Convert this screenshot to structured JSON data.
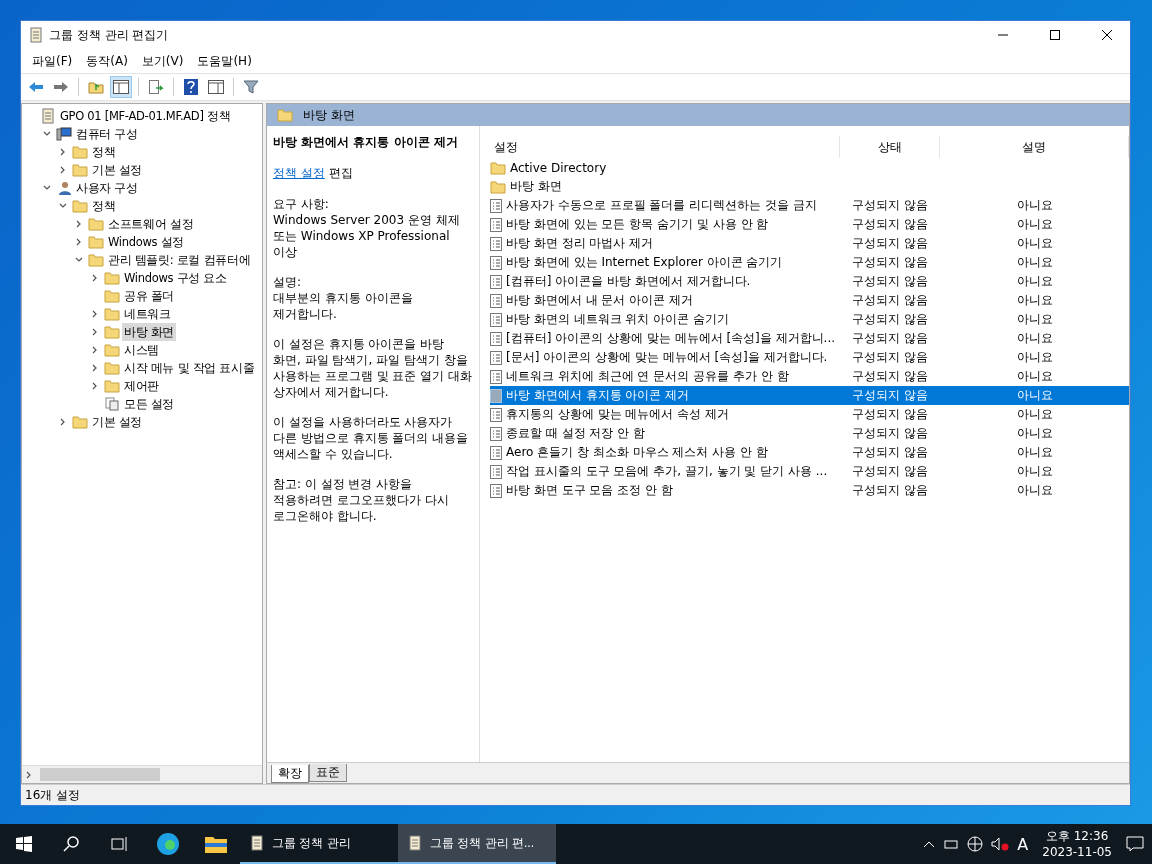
{
  "window": {
    "title": "그룹 정책 관리 편집기"
  },
  "menu": [
    "파일(F)",
    "동작(A)",
    "보기(V)",
    "도움말(H)"
  ],
  "toolbar": [
    {
      "kind": "back"
    },
    {
      "kind": "forward"
    },
    {
      "kind": "sep"
    },
    {
      "kind": "up"
    },
    {
      "kind": "pane",
      "selected": true
    },
    {
      "kind": "sep"
    },
    {
      "kind": "export"
    },
    {
      "kind": "sep"
    },
    {
      "kind": "help"
    },
    {
      "kind": "pane2"
    },
    {
      "kind": "sep"
    },
    {
      "kind": "filter"
    }
  ],
  "tree": [
    {
      "label": "GPO 01 [MF-AD-01.MF.AD] 정책",
      "kind": "policy",
      "expandable": false,
      "selected": false,
      "children": [
        {
          "label": "컴퓨터 구성",
          "kind": "computer",
          "expandable": true,
          "expanded": true,
          "selected": false,
          "children": [
            {
              "label": "정책",
              "kind": "folder",
              "expandable": true,
              "expanded": false,
              "selected": false
            },
            {
              "label": "기본 설정",
              "kind": "folder",
              "expandable": true,
              "expanded": false,
              "selected": false
            }
          ]
        },
        {
          "label": "사용자 구성",
          "kind": "user",
          "expandable": true,
          "expanded": true,
          "selected": false,
          "children": [
            {
              "label": "정책",
              "kind": "folder",
              "expandable": true,
              "expanded": true,
              "selected": false,
              "children": [
                {
                  "label": "소프트웨어 설정",
                  "kind": "folder",
                  "expandable": true,
                  "expanded": false,
                  "selected": false
                },
                {
                  "label": "Windows 설정",
                  "kind": "folder",
                  "expandable": true,
                  "expanded": false,
                  "selected": false
                },
                {
                  "label": "관리 템플릿: 로컬 컴퓨터에",
                  "kind": "folder",
                  "expandable": true,
                  "expanded": true,
                  "selected": false,
                  "children": [
                    {
                      "label": "Windows 구성 요소",
                      "kind": "folder",
                      "expandable": true,
                      "expanded": false,
                      "selected": false
                    },
                    {
                      "label": "공유 폴더",
                      "kind": "folder",
                      "expandable": false,
                      "selected": false
                    },
                    {
                      "label": "네트워크",
                      "kind": "folder",
                      "expandable": true,
                      "expanded": false,
                      "selected": false
                    },
                    {
                      "label": "바탕 화면",
                      "kind": "folder",
                      "expandable": true,
                      "expanded": false,
                      "selected": true
                    },
                    {
                      "label": "시스템",
                      "kind": "folder",
                      "expandable": true,
                      "expanded": false,
                      "selected": false
                    },
                    {
                      "label": "시작 메뉴 및 작업 표시줄",
                      "kind": "folder",
                      "expandable": true,
                      "expanded": false,
                      "selected": false
                    },
                    {
                      "label": "제어판",
                      "kind": "folder",
                      "expandable": true,
                      "expanded": false,
                      "selected": false
                    },
                    {
                      "label": "모든 설정",
                      "kind": "settings",
                      "expandable": false,
                      "selected": false
                    }
                  ]
                }
              ]
            },
            {
              "label": "기본 설정",
              "kind": "folder",
              "expandable": true,
              "expanded": false,
              "selected": false
            }
          ]
        }
      ]
    }
  ],
  "header": {
    "title": "바탕 화면"
  },
  "description": {
    "title": "바탕 화면에서 휴지통 아이콘 제거",
    "link": "정책 설정",
    "link_suffix": "편집",
    "paragraphs": [
      "요구 사항:\nWindows Server 2003 운영 체제 또는 Windows XP Professional 이상",
      "설명:\n대부분의 휴지통 아이콘을 제거합니다.",
      "이 설정은 휴지통 아이콘을 바탕 화면, 파일 탐색기, 파일 탐색기 창을 사용하는 프로그램 및 표준 열기 대화 상자에서 제거합니다.",
      "이 설정을 사용하더라도 사용자가 다른 방법으로 휴지통 폴더의 내용을 액세스할 수 있습니다.",
      "참고: 이 설정 변경 사항을 적용하려면 로그오프했다가 다시 로그온해야 합니다."
    ]
  },
  "table": {
    "columns": [
      "설정",
      "상태",
      "설명"
    ],
    "rows": [
      {
        "kind": "folder",
        "name": "Active Directory",
        "selected": false
      },
      {
        "kind": "folder",
        "name": "바탕 화면",
        "selected": false
      },
      {
        "kind": "setting",
        "name": "사용자가 수동으로 프로필 폴더를 리디렉션하는 것을 금지",
        "state": "구성되지 않음",
        "comment": "아니요",
        "selected": false
      },
      {
        "kind": "setting",
        "name": "바탕 화면에 있는 모든 항목 숨기기 및 사용 안 함",
        "state": "구성되지 않음",
        "comment": "아니요",
        "selected": false
      },
      {
        "kind": "setting",
        "name": "바탕 화면 정리 마법사 제거",
        "state": "구성되지 않음",
        "comment": "아니요",
        "selected": false
      },
      {
        "kind": "setting",
        "name": "바탕 화면에 있는 Internet Explorer 아이콘 숨기기",
        "state": "구성되지 않음",
        "comment": "아니요",
        "selected": false
      },
      {
        "kind": "setting",
        "name": "[컴퓨터] 아이콘을 바탕 화면에서 제거합니다.",
        "state": "구성되지 않음",
        "comment": "아니요",
        "selected": false
      },
      {
        "kind": "setting",
        "name": "바탕 화면에서 내 문서 아이콘 제거",
        "state": "구성되지 않음",
        "comment": "아니요",
        "selected": false
      },
      {
        "kind": "setting",
        "name": "바탕 화면의 네트워크 위치 아이콘 숨기기",
        "state": "구성되지 않음",
        "comment": "아니요",
        "selected": false
      },
      {
        "kind": "setting",
        "name": "[컴퓨터] 아이콘의 상황에 맞는 메뉴에서 [속성]을 제거합니...",
        "state": "구성되지 않음",
        "comment": "아니요",
        "selected": false
      },
      {
        "kind": "setting",
        "name": "[문서] 아이콘의 상황에 맞는 메뉴에서 [속성]을 제거합니다.",
        "state": "구성되지 않음",
        "comment": "아니요",
        "selected": false
      },
      {
        "kind": "setting",
        "name": "네트워크 위치에 최근에 연 문서의 공유를 추가 안 함",
        "state": "구성되지 않음",
        "comment": "아니요",
        "selected": false
      },
      {
        "kind": "setting",
        "name": "바탕 화면에서 휴지통 아이콘 제거",
        "state": "구성되지 않음",
        "comment": "아니요",
        "selected": true
      },
      {
        "kind": "setting",
        "name": "휴지통의 상황에 맞는 메뉴에서 속성 제거",
        "state": "구성되지 않음",
        "comment": "아니요",
        "selected": false
      },
      {
        "kind": "setting",
        "name": "종료할 때 설정 저장 안 함",
        "state": "구성되지 않음",
        "comment": "아니요",
        "selected": false
      },
      {
        "kind": "setting",
        "name": "Aero 흔들기 창 최소화 마우스 제스처 사용 안 함",
        "state": "구성되지 않음",
        "comment": "아니요",
        "selected": false
      },
      {
        "kind": "setting",
        "name": "작업 표시줄의 도구 모음에 추가, 끌기, 놓기 및 닫기 사용 ...",
        "state": "구성되지 않음",
        "comment": "아니요",
        "selected": false
      },
      {
        "kind": "setting",
        "name": "바탕 화면 도구 모음 조정 안 함",
        "state": "구성되지 않음",
        "comment": "아니요",
        "selected": false
      }
    ]
  },
  "view_tabs": [
    {
      "label": "확장",
      "selected": true
    },
    {
      "label": "표준",
      "selected": false
    }
  ],
  "status_bar": {
    "text": "16개 설정"
  },
  "taskbar": {
    "apps": [
      {
        "label": "그룹 정책 관리",
        "active": false
      },
      {
        "label": "그룹 정책 관리 편...",
        "active": true
      }
    ],
    "ime": "A",
    "time": "오후 12:36",
    "date": "2023-11-05"
  }
}
